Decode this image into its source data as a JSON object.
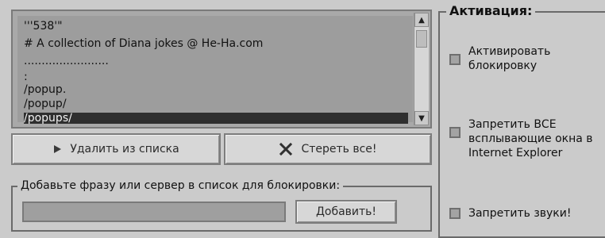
{
  "list": {
    "lines": [
      "'''538'\"",
      "# A collection of Diana jokes @ He-Ha.com",
      "........................",
      ":",
      "/popup.",
      "/popup/",
      "/popups/"
    ]
  },
  "buttons": {
    "delete_label": "Удалить из списка",
    "clear_label": "Стереть все!",
    "add_label": "Добавить!"
  },
  "add_group": {
    "title": "Добавьте фразу или сервер в список для блокировки:",
    "input_value": ""
  },
  "activation": {
    "title": "Активация:",
    "activate_label": "Активировать блокировку",
    "popups_label": "Запретить ВСЕ всплывающие окна в Internet Explorer",
    "sounds_label": "Запретить звуки!"
  }
}
